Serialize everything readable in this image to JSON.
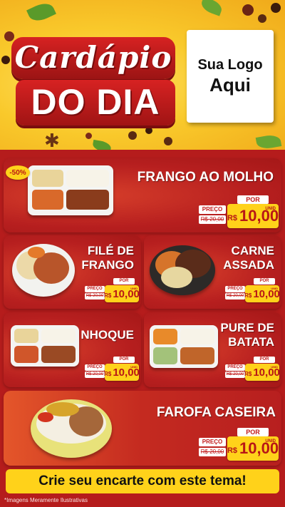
{
  "header": {
    "title_line1": "Cardápio",
    "title_line2": "DO DIA",
    "logo_line1": "Sua Logo",
    "logo_line2": "Aqui"
  },
  "badge": "-50%",
  "items": [
    {
      "name": "FRANGO AO MOLHO",
      "por": "POR",
      "preco_label": "PREÇO",
      "old_price": "R$ 20,00",
      "currency": "R$",
      "price": "10,00",
      "unit": "UNID"
    },
    {
      "name_line1": "FILÉ DE",
      "name_line2": "FRANGO",
      "por": "POR",
      "preco_label": "PREÇO",
      "old_price": "R$ 20,00",
      "currency": "R$",
      "price": "10,00",
      "unit": "UNID"
    },
    {
      "name_line1": "CARNE",
      "name_line2": "ASSADA",
      "por": "POR",
      "preco_label": "PREÇO",
      "old_price": "R$ 20,00",
      "currency": "R$",
      "price": "10,00",
      "unit": "UNID"
    },
    {
      "name": "NHOQUE",
      "por": "POR",
      "preco_label": "PREÇO",
      "old_price": "R$ 20,00",
      "currency": "R$",
      "price": "10,00",
      "unit": "UNID"
    },
    {
      "name_line1": "PURE DE",
      "name_line2": "BATATA",
      "por": "POR",
      "preco_label": "PREÇO",
      "old_price": "R$ 20,00",
      "currency": "R$",
      "price": "10,00",
      "unit": "UNID"
    },
    {
      "name": "FAROFA CASEIRA",
      "por": "POR",
      "preco_label": "PREÇO",
      "old_price": "R$ 20,00",
      "currency": "R$",
      "price": "10,00",
      "unit": "UNID"
    }
  ],
  "footer": {
    "cta": "Crie seu encarte com este tema!",
    "disclaimer": "*Imagens Meramente Ilustrativas"
  },
  "colors": {
    "background_red": "#b51c1c",
    "header_yellow": "#f9c92b",
    "price_yellow": "#ffd21a",
    "price_red": "#b81616"
  }
}
